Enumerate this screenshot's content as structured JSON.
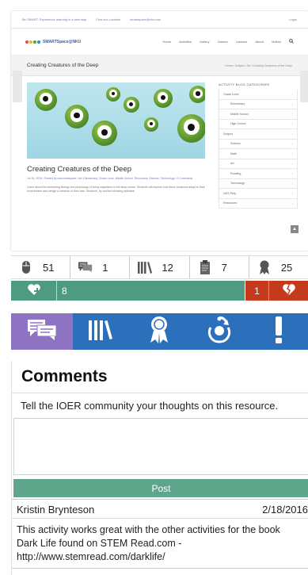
{
  "thumbnail": {
    "topbar_items": [
      "Be SMART: Experience learning in a new way",
      "Find our Location",
      "smartspace@nku.edu"
    ],
    "login": "Login",
    "logo_text": "SMARTSpace@NKU",
    "nav": [
      "Home",
      "Activities",
      "Gallery",
      "Games",
      "Lessons",
      "About",
      "Videos"
    ],
    "page_title": "Creating Creatures of the Deep",
    "breadcrumb": "Home / Subject / Art / Creating Creatures of the Deep",
    "post_title": "Creating Creatures of the Deep",
    "post_meta": "Jul 20, 2016 / Posted by nkusmartspace / Art, Elementary, Grade Level, Middle School, Resources, Science, Technology / 0 Comments",
    "post_text": "Learn about the interesting biology and physiology of living organisms in the deep ocean. Students will explore how these creatures adapt to their environment and design a creature of their own. Students, try out the following activities:",
    "categories_title": "ACTIVITY BLOG CATEGORIES",
    "categories": [
      {
        "label": "Grade Level",
        "child": false
      },
      {
        "label": "Elementary",
        "child": true
      },
      {
        "label": "Middle School",
        "child": true
      },
      {
        "label": "High School",
        "child": true
      },
      {
        "label": "Subject",
        "child": false
      },
      {
        "label": "Science",
        "child": true
      },
      {
        "label": "Math",
        "child": true
      },
      {
        "label": "Art",
        "child": true
      },
      {
        "label": "Reading",
        "child": true
      },
      {
        "label": "Technology",
        "child": true
      },
      {
        "label": "NGS Prep",
        "child": false
      },
      {
        "label": "Resources",
        "child": false
      }
    ]
  },
  "stats": [
    {
      "icon": "mouse-icon",
      "value": "51"
    },
    {
      "icon": "comments-icon",
      "value": "1"
    },
    {
      "icon": "library-icon",
      "value": "12"
    },
    {
      "icon": "standards-icon",
      "value": "7"
    },
    {
      "icon": "award-icon",
      "value": "25"
    }
  ],
  "rating": {
    "likes": "8",
    "dislikes": "1",
    "like_fraction": 0.89,
    "colors": {
      "like": "#4f9a82",
      "dislike": "#c33a1d"
    }
  },
  "tabs": [
    {
      "name": "comments-tab",
      "icon": "comments-icon",
      "color": "#8e73c2"
    },
    {
      "name": "library-tab",
      "icon": "library-icon",
      "color": "#2c6fbb"
    },
    {
      "name": "evaluate-tab",
      "icon": "award-icon",
      "color": "#2c6fbb"
    },
    {
      "name": "share-tab",
      "icon": "share-icon",
      "color": "#2c6fbb"
    },
    {
      "name": "report-tab",
      "icon": "exclamation-icon",
      "color": "#2c6fbb"
    }
  ],
  "comments": {
    "heading": "Comments",
    "prompt": "Tell the IOER community your thoughts on this resource.",
    "input_value": "",
    "post_label": "Post",
    "entries": [
      {
        "author": "Kristin Brynteson",
        "date": "2/18/2016",
        "text": "This activity works great with the other activities for the book Dark Life found on STEM Read.com - http://www.stemread.com/darklife/"
      }
    ]
  }
}
